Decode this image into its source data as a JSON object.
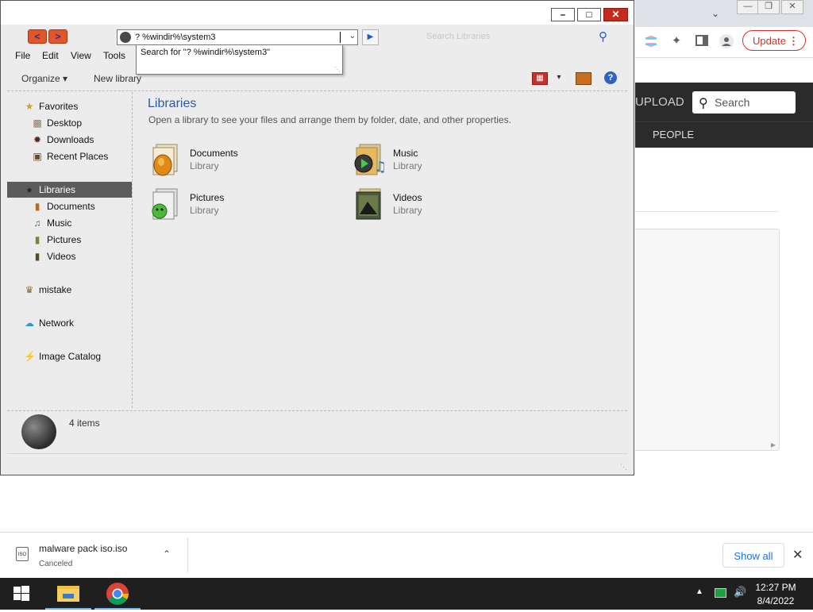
{
  "explorer": {
    "address_value": "? %windir%\\system3",
    "search_placeholder": "Search Libraries",
    "suggestion": "Search for \"? %windir%\\system3\"",
    "menu": [
      "File",
      "Edit",
      "View",
      "Tools"
    ],
    "organize_label": "Organize",
    "new_library_label": "New library",
    "help_label": "?",
    "nav": {
      "favorites": "Favorites",
      "desktop": "Desktop",
      "downloads": "Downloads",
      "recent_places": "Recent Places",
      "libraries": "Libraries",
      "documents": "Documents",
      "music": "Music",
      "pictures": "Pictures",
      "videos": "Videos",
      "mistake": "mistake",
      "network": "Network",
      "image_catalog": "Image Catalog"
    },
    "content": {
      "title": "Libraries",
      "description": "Open a library to see your files and arrange them by folder, date, and other properties.",
      "libraries": [
        {
          "name": "Documents",
          "type": "Library"
        },
        {
          "name": "Music",
          "type": "Library"
        },
        {
          "name": "Pictures",
          "type": "Library"
        },
        {
          "name": "Videos",
          "type": "Library"
        }
      ]
    },
    "item_count": "4 items"
  },
  "browser": {
    "update_label": "Update",
    "upload_label": "UPLOAD",
    "search_placeholder": "Search",
    "people_label": "PEOPLE"
  },
  "downloads": {
    "file_name": "malware pack iso.iso",
    "file_status": "Canceled",
    "show_all_label": "Show all"
  },
  "taskbar": {
    "time": "12:27 PM",
    "date": "8/4/2022"
  },
  "colors": {
    "selection": "#5c5c5c",
    "title_blue": "#2a5aa6",
    "close_red": "#c42b1c",
    "update_red": "#d93025",
    "link_blue": "#1a73e8"
  }
}
